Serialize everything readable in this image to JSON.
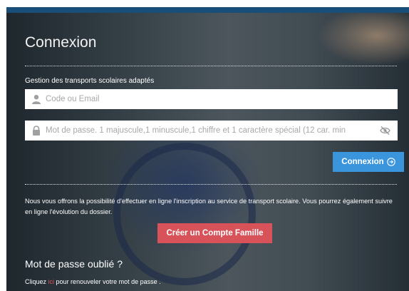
{
  "login": {
    "title": "Connexion",
    "subtitle": "Gestion des transports scolaires adaptés",
    "code_placeholder": "Code ou Email",
    "password_placeholder": "Mot de passe. 1 majuscule,1 minuscule,1 chiffre et 1 caractère spécial (12 car. min",
    "submit_label": "Connexion"
  },
  "info": {
    "text": "Nous vous offrons la possibilité d'effectuer en ligne l'inscription au service de transport scolaire. Vous pourrez également suivre en ligne l'évolution du dossier.",
    "create_account_label": "Créer un Compte Famille"
  },
  "forgot": {
    "title": "Mot de passe oublié ?",
    "prefix": "Cliquez",
    "link_label": "ici",
    "suffix": "pour renouveler votre mot de passe ."
  },
  "icons": {
    "user": "person-icon",
    "lock": "lock-icon",
    "eye": "eye-slash-icon",
    "submit": "circle-arrow-right-icon"
  },
  "colors": {
    "primary_button": "#3a95dc",
    "create_button": "#d8525a",
    "link": "#d8525a"
  }
}
